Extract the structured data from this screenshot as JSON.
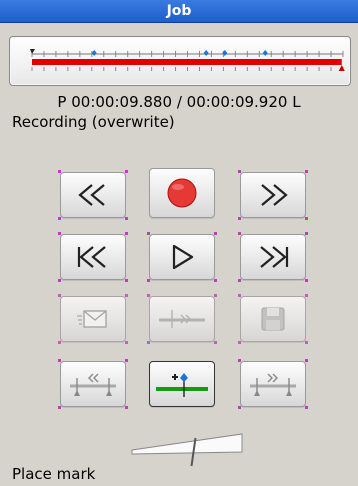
{
  "window": {
    "title": "Job"
  },
  "status": {
    "position_label": "P",
    "position_time": "00:00:09.880",
    "separator": "/",
    "length_time": "00:00:09.920",
    "length_label": "L",
    "mode": "Recording (overwrite)",
    "hint": "Place mark"
  },
  "timeline": {
    "progress": 0.996,
    "marks_fraction": [
      0.2,
      0.56,
      0.62,
      0.75
    ],
    "colors": {
      "track": "#e00000",
      "mark": "#1a73d9",
      "cursor": "#c00000"
    }
  },
  "buttons": [
    {
      "id": "rewind",
      "icon": "rewind-icon",
      "enabled": true,
      "selected": false
    },
    {
      "id": "record",
      "icon": "record-icon",
      "enabled": true,
      "selected": false
    },
    {
      "id": "fast-forward",
      "icon": "fast-forward-icon",
      "enabled": true,
      "selected": false
    },
    {
      "id": "go-start",
      "icon": "go-to-start-icon",
      "enabled": true,
      "selected": false
    },
    {
      "id": "play",
      "icon": "play-icon",
      "enabled": true,
      "selected": false
    },
    {
      "id": "go-end",
      "icon": "go-to-end-icon",
      "enabled": true,
      "selected": false
    },
    {
      "id": "send",
      "icon": "envelope-icon",
      "enabled": false,
      "selected": false
    },
    {
      "id": "trim",
      "icon": "trim-icon",
      "enabled": false,
      "selected": false
    },
    {
      "id": "save",
      "icon": "floppy-icon",
      "enabled": false,
      "selected": false
    },
    {
      "id": "prev-mark",
      "icon": "previous-mark-icon",
      "enabled": true,
      "selected": false
    },
    {
      "id": "place-mark",
      "icon": "place-mark-icon",
      "enabled": true,
      "selected": true
    },
    {
      "id": "next-mark",
      "icon": "next-mark-icon",
      "enabled": true,
      "selected": false
    }
  ],
  "volume": {
    "level": 0.55
  },
  "colors": {
    "titlebar": "#2a6fdb",
    "record": "#e53935",
    "accent_green": "#159a15"
  }
}
